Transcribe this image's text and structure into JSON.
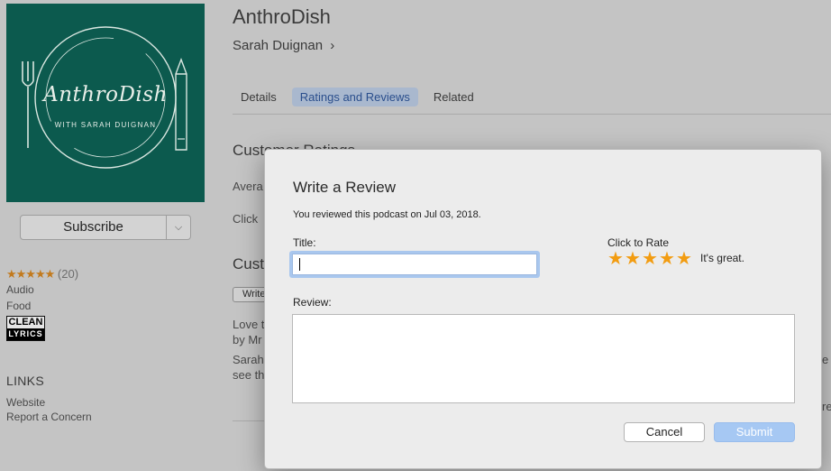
{
  "podcast": {
    "title": "AnthroDish",
    "author": "Sarah Duignan",
    "author_chevron": "›",
    "artwork_title": "AnthroDish",
    "artwork_subtitle": "WITH SARAH DUIGNAN",
    "artwork_bg": "#0c5a4e"
  },
  "subscribe": {
    "label": "Subscribe",
    "menu_icon": "chevron-down-icon"
  },
  "sidebar": {
    "rating_stars": "★★★★★",
    "rating_count": "(20)",
    "type": "Audio",
    "category": "Food",
    "clean_badge": {
      "top": "CLEAN",
      "bottom": "LYRICS"
    },
    "links_heading": "LINKS",
    "links": [
      "Website",
      "Report a Concern"
    ]
  },
  "tabs": [
    {
      "label": "Details",
      "active": false
    },
    {
      "label": "Ratings and Reviews",
      "active": true
    },
    {
      "label": "Related",
      "active": false
    }
  ],
  "background": {
    "customer_ratings_heading": "Customer Ratings",
    "avg_fragment": "Avera",
    "click_fragment": "Click",
    "cust_fragment": "Cust",
    "write_btn_fragment": "Write",
    "love_fragment": "Love t",
    "by_fragment": "by Mr",
    "sarah_fragment": "Sarah",
    "see_fragment": "see th",
    "right_fragment_1": "e",
    "right_fragment_2": "re"
  },
  "dialog": {
    "heading": "Write a Review",
    "subtitle": "You reviewed this podcast on Jul 03, 2018.",
    "title_label": "Title:",
    "title_value": "",
    "review_label": "Review:",
    "review_value": "",
    "rate_label": "Click to Rate",
    "rating": 5,
    "rating_max": 5,
    "rating_text": "It's great.",
    "cancel_label": "Cancel",
    "submit_label": "Submit",
    "star_color": "#f29c11",
    "submit_color": "#a6c8f3"
  }
}
